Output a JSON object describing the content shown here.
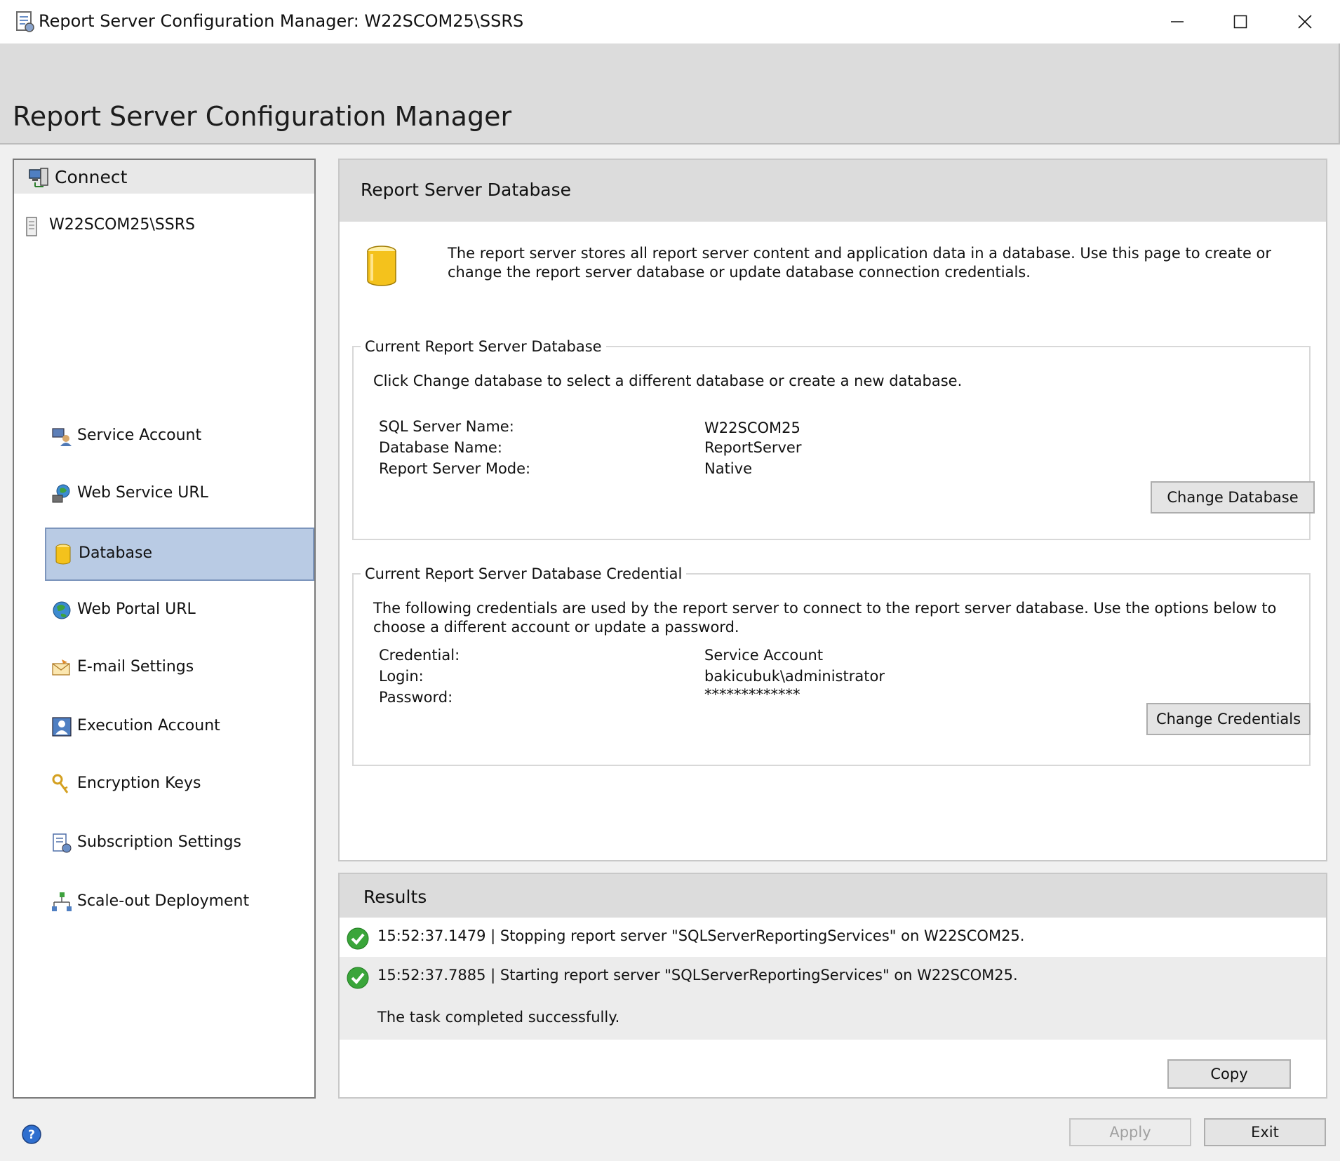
{
  "window": {
    "title": "Report Server Configuration Manager: W22SCOM25\\SSRS",
    "controls": [
      "minimize",
      "maximize",
      "close"
    ]
  },
  "banner": {
    "title": "Report Server Configuration Manager"
  },
  "nav": {
    "connect_label": "Connect",
    "server": "W22SCOM25\\SSRS",
    "items": [
      {
        "label": "Service Account",
        "icon": "service-account-icon"
      },
      {
        "label": "Web Service URL",
        "icon": "web-service-url-icon"
      },
      {
        "label": "Database",
        "icon": "database-icon",
        "selected": true
      },
      {
        "label": "Web Portal URL",
        "icon": "globe-icon"
      },
      {
        "label": "E-mail Settings",
        "icon": "email-icon"
      },
      {
        "label": "Execution Account",
        "icon": "execution-account-icon"
      },
      {
        "label": "Encryption Keys",
        "icon": "keys-icon"
      },
      {
        "label": "Subscription Settings",
        "icon": "subscription-icon"
      },
      {
        "label": "Scale-out Deployment",
        "icon": "scale-out-icon"
      }
    ]
  },
  "panel": {
    "title": "Report Server Database",
    "intro": "The report server stores all report server content and application data in a database. Use this page to create or change the report server database or update database connection credentials.",
    "current_db": {
      "legend": "Current Report Server Database",
      "description": "Click Change database to select a different database or create a new database.",
      "fields": [
        {
          "label": "SQL Server Name:",
          "value": "W22SCOM25"
        },
        {
          "label": "Database Name:",
          "value": "ReportServer"
        },
        {
          "label": "Report Server Mode:",
          "value": "Native"
        }
      ],
      "button": "Change Database"
    },
    "credential": {
      "legend": "Current Report Server Database Credential",
      "description": "The following credentials are used by the report server to connect to the report server database.  Use the options below to choose a different account or update a password.",
      "fields": [
        {
          "label": "Credential:",
          "value": "Service Account"
        },
        {
          "label": "Login:",
          "value": "bakicubuk\\administrator"
        },
        {
          "label": "Password:",
          "value": "*************"
        }
      ],
      "button": "Change Credentials"
    }
  },
  "results": {
    "title": "Results",
    "rows": [
      {
        "text": "15:52:37.1479 | Stopping report server \"SQLServerReportingServices\" on W22SCOM25.",
        "status": "success"
      },
      {
        "text": "15:52:37.7885 | Starting report server \"SQLServerReportingServices\" on W22SCOM25.",
        "status": "success",
        "detail": "The task completed successfully."
      }
    ],
    "copy_button": "Copy"
  },
  "footer": {
    "apply": "Apply",
    "exit": "Exit"
  },
  "colors": {
    "selected_bg": "#b9cbe4",
    "header_bg": "#dcdcdc",
    "success": "#3aa53a"
  }
}
